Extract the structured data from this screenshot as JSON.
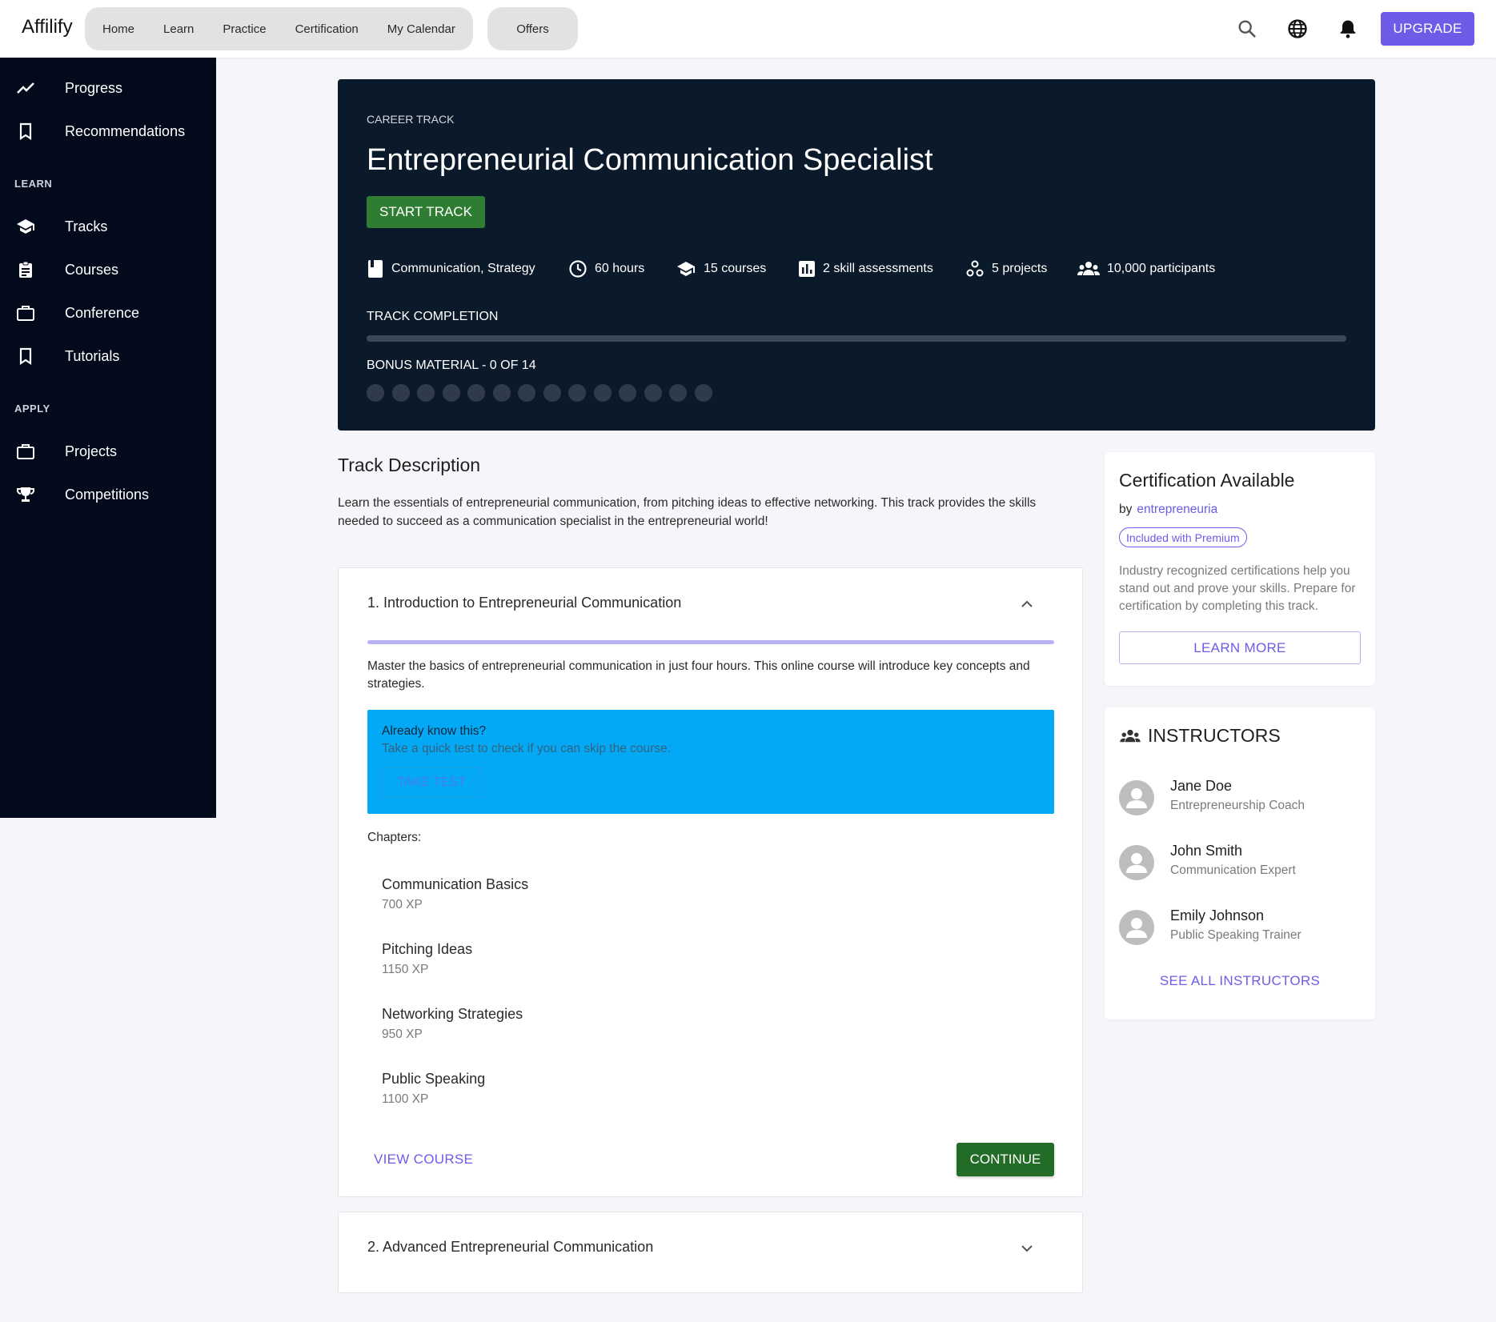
{
  "header": {
    "brand": "Affilify",
    "nav": [
      "Home",
      "Learn",
      "Practice",
      "Certification",
      "My Calendar"
    ],
    "offers": "Offers",
    "icons": [
      "search-icon",
      "globe-icon",
      "bell-icon"
    ],
    "upgrade": "UPGRADE",
    "accent": "#6c5ce7"
  },
  "sidebar": {
    "top_items": [
      {
        "label": "Progress",
        "icon": "trending-up-icon"
      },
      {
        "label": "Recommendations",
        "icon": "bookmark-icon"
      }
    ],
    "learn_heading": "LEARN",
    "learn_items": [
      {
        "label": "Tracks",
        "icon": "school-icon"
      },
      {
        "label": "Courses",
        "icon": "assignment-icon"
      },
      {
        "label": "Conference",
        "icon": "briefcase-icon"
      },
      {
        "label": "Tutorials",
        "icon": "bookmark-icon"
      }
    ],
    "apply_heading": "APPLY",
    "apply_items": [
      {
        "label": "Projects",
        "icon": "briefcase-icon"
      },
      {
        "label": "Competitions",
        "icon": "trophy-icon"
      }
    ]
  },
  "hero": {
    "kicker": "CAREER TRACK",
    "title": "Entrepreneurial Communication Specialist",
    "start_button": "START TRACK",
    "stats": {
      "topics": "Communication, Strategy",
      "hours": "60 hours",
      "courses": "15 courses",
      "assessments": "2 skill assessments",
      "projects": "5 projects",
      "participants": "10,000 participants"
    },
    "completion_label": "TRACK COMPLETION",
    "completion_fraction": 0,
    "bonus_label": "BONUS MATERIAL - 0 OF 14",
    "bonus_total": 14,
    "bonus_done": 0
  },
  "description": {
    "title": "Track Description",
    "text": "Learn the essentials of entrepreneurial communication, from pitching ideas to effective networking. This track provides the skills needed to succeed as a communication specialist in the entrepreneurial world!"
  },
  "course1": {
    "title": "1. Introduction to Entrepreneurial Communication",
    "description": "Master the basics of entrepreneurial communication in just four hours. This online course will introduce key concepts and strategies.",
    "know_title": "Already know this?",
    "know_text": "Take a quick test to check if you can skip the course.",
    "take_test": "TAKE TEST",
    "chapters_label": "Chapters:",
    "chapters": [
      {
        "name": "Communication Basics",
        "xp": "700 XP"
      },
      {
        "name": "Pitching Ideas",
        "xp": "1150 XP"
      },
      {
        "name": "Networking Strategies",
        "xp": "950 XP"
      },
      {
        "name": "Public Speaking",
        "xp": "1100 XP"
      }
    ],
    "view_course": "VIEW COURSE",
    "continue": "CONTINUE"
  },
  "course2": {
    "title": "2. Advanced Entrepreneurial Communication"
  },
  "certification": {
    "title": "Certification Available",
    "by": "by",
    "provider": "entrepreneuria",
    "badge": "Included with Premium",
    "text": "Industry recognized certifications help you stand out and prove your skills. Prepare for certification by completing this track.",
    "learn_more": "LEARN MORE"
  },
  "instructors": {
    "title": "INSTRUCTORS",
    "list": [
      {
        "name": "Jane Doe",
        "role": "Entrepreneurship Coach"
      },
      {
        "name": "John Smith",
        "role": "Communication Expert"
      },
      {
        "name": "Emily Johnson",
        "role": "Public Speaking Trainer"
      }
    ],
    "see_all": "SEE ALL INSTRUCTORS"
  }
}
